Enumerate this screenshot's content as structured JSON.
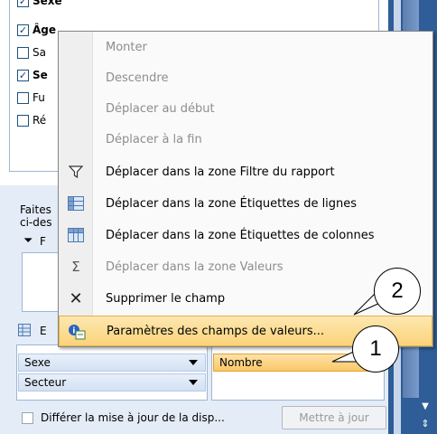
{
  "field_list": {
    "items": [
      {
        "label": "Sexe",
        "checked": true,
        "bold": true
      },
      {
        "label": "Âge",
        "checked": true,
        "bold": true
      },
      {
        "label": "Sa",
        "checked": false,
        "bold": false
      },
      {
        "label": "Se",
        "checked": true,
        "bold": true
      },
      {
        "label": "Fu",
        "checked": false,
        "bold": false
      },
      {
        "label": "Ré",
        "checked": false,
        "bold": false
      }
    ]
  },
  "lower": {
    "instruction_1": "Faites",
    "instruction_2": "ci-des",
    "filter_label": "F",
    "values_label": "E",
    "row_fields": [
      "Sexe",
      "Secteur"
    ],
    "value_field": "Nombre"
  },
  "defer": {
    "label": "Différer la mise à jour de la disp...",
    "checked": false
  },
  "update_button": "Mettre à jour",
  "context_menu": {
    "items": [
      {
        "label": "Monter",
        "disabled": true,
        "icon": "none"
      },
      {
        "label": "Descendre",
        "disabled": true,
        "icon": "none"
      },
      {
        "label": "Déplacer au début",
        "disabled": true,
        "icon": "none"
      },
      {
        "label": "Déplacer à la fin",
        "disabled": true,
        "icon": "none"
      },
      {
        "label": "Déplacer dans la zone Filtre du rapport",
        "disabled": false,
        "icon": "filter-icon"
      },
      {
        "label": "Déplacer dans la zone Étiquettes de lignes",
        "disabled": false,
        "icon": "row-labels-icon"
      },
      {
        "label": "Déplacer dans la zone Étiquettes de colonnes",
        "disabled": false,
        "icon": "column-labels-icon"
      },
      {
        "label": "Déplacer dans la zone Valeurs",
        "disabled": true,
        "icon": "sigma-icon"
      },
      {
        "label": "Supprimer le champ",
        "disabled": false,
        "icon": "close-icon"
      },
      {
        "label": "Paramètres des champs de valeurs...",
        "disabled": false,
        "icon": "value-field-settings-icon",
        "highlighted": true
      }
    ]
  },
  "callouts": {
    "one": "1",
    "two": "2"
  },
  "colors": {
    "highlight": "#fbd37a",
    "pane_blue": "#2e5d97",
    "panel_bg": "#e4ecf7"
  }
}
